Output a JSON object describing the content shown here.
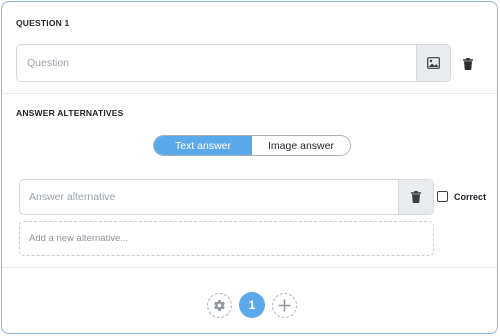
{
  "question": {
    "title": "QUESTION 1",
    "placeholder": "Question",
    "value": ""
  },
  "answers": {
    "title": "ANSWER ALTERNATIVES",
    "toggle": {
      "options": [
        "Text answer",
        "Image answer"
      ],
      "selected": "Text answer"
    },
    "alternatives": [
      {
        "placeholder": "Answer alternative",
        "value": "",
        "correct_label": "Correct",
        "correct": false
      }
    ],
    "add_placeholder": "Add a new alternative..."
  },
  "footer": {
    "current_page": "1"
  },
  "icons": {
    "image": "image-icon",
    "trash": "trash-icon",
    "gear": "gear-icon",
    "plus": "plus-icon"
  },
  "colors": {
    "accent": "#5ba8ea",
    "frame_border": "#8fb6de",
    "icon_dark": "#3a3f45"
  }
}
